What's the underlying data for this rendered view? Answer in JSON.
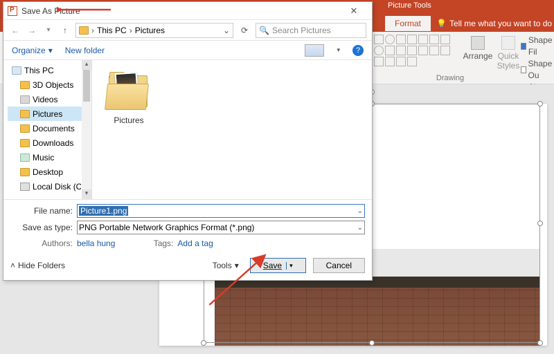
{
  "ppt": {
    "tools_label": "Picture Tools",
    "tab_format": "Format",
    "tell_me": "Tell me what you want to do",
    "shape_fill": "Shape Fil",
    "shape_outline": "Shape Ou",
    "shape_effects": "Shape Eff",
    "arrange": "Arrange",
    "quick_styles": "Quick Styles",
    "group_drawing": "Drawing"
  },
  "dialog": {
    "title": "Save As Picture",
    "path": {
      "root": "This PC",
      "current": "Pictures"
    },
    "search_placeholder": "Search Pictures",
    "organize": "Organize",
    "new_folder": "New folder",
    "help": "?",
    "tree": {
      "this_pc": "This PC",
      "objects3d": "3D Objects",
      "videos": "Videos",
      "pictures": "Pictures",
      "documents": "Documents",
      "downloads": "Downloads",
      "music": "Music",
      "desktop": "Desktop",
      "local_disk": "Local Disk (C:)"
    },
    "content_folder": "Pictures",
    "filename_label": "File name:",
    "filename_value": "Picture1.png",
    "saveastype_label": "Save as type:",
    "saveastype_value": "PNG Portable Network Graphics Format (*.png)",
    "authors_label": "Authors:",
    "authors_value": "bella hung",
    "tags_label": "Tags:",
    "tags_value": "Add a tag",
    "hide_folders": "Hide Folders",
    "tools": "Tools",
    "save": "Save",
    "cancel": "Cancel"
  }
}
